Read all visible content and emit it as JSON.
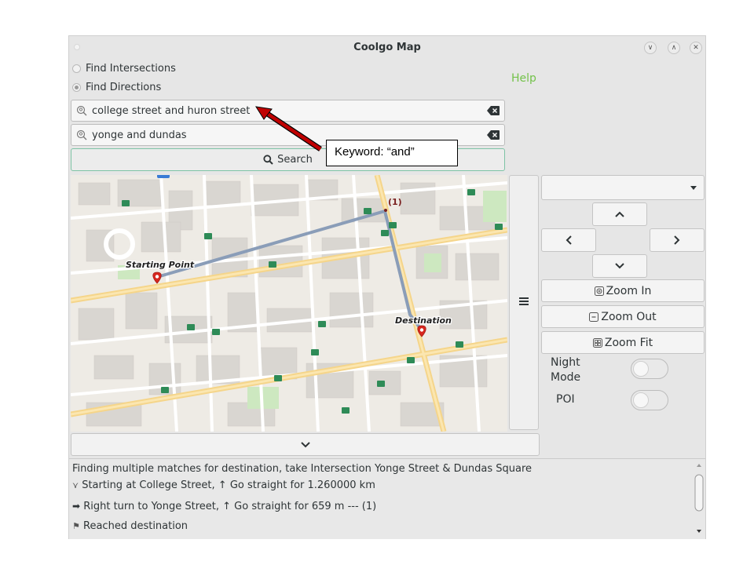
{
  "window": {
    "title": "Coolgo Map",
    "buttons": [
      "minimize-icon",
      "maximize-icon",
      "close-icon"
    ]
  },
  "mode": {
    "options": [
      "Find Intersections",
      "Find Directions"
    ],
    "selected": "Find Directions"
  },
  "help_label": "Help",
  "search": {
    "from_value": "college street and huron street",
    "to_value": "yonge and dundas",
    "button_label": "Search",
    "icon": "search-icon"
  },
  "map": {
    "start_label": "Starting Point",
    "destination_label": "Destination",
    "marker_label": "(1)"
  },
  "controls": {
    "dropdown_value": "",
    "zoom_in": "Zoom In",
    "zoom_out": "Zoom Out",
    "zoom_fit": "Zoom Fit",
    "night_mode": "Night Mode",
    "poi": "POI",
    "night_mode_on": false,
    "poi_on": false
  },
  "directions": [
    "Finding multiple matches for destination, take Intersection Yonge Street & Dundas Square",
    "Starting at College Street, ↑ Go straight for 1.260000 km",
    "Right turn to Yonge Street, ↑ Go straight for 659 m --- (1)",
    "Reached destination"
  ],
  "annotation": {
    "text": "Keyword: “and”",
    "color": "#c00000"
  },
  "colors": {
    "accent_green": "#73c24a",
    "route": "#8a9db8",
    "major_road": "#f7d98a",
    "marker_red": "#d7261e",
    "poi_green": "#2e8b57"
  }
}
